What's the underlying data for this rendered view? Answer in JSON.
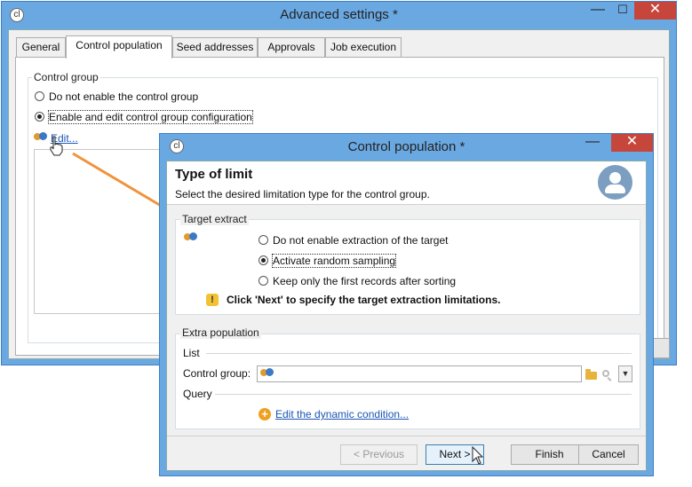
{
  "back_window": {
    "title": "Advanced settings *",
    "minimize": "—",
    "maximize": "☐",
    "close": "✕",
    "tabs": [
      "General",
      "Control population",
      "Seed addresses",
      "Approvals",
      "Job execution"
    ],
    "group_label": "Control group",
    "option_disable": "Do not enable the control group",
    "option_enable": "Enable and edit control group configuration",
    "edit_link": "Edit..."
  },
  "dialog": {
    "title": "Control population *",
    "minimize": "—",
    "close": "✕",
    "header_title": "Type of limit",
    "header_subtitle": "Select the desired limitation type for the control group.",
    "target_extract_label": "Target extract",
    "option_no_extraction": "Do not enable extraction of the target",
    "option_random_sampling": "Activate random sampling",
    "option_first_records": "Keep only the first records after sorting",
    "warning_text": "Click 'Next' to specify the target extraction limitations.",
    "extra_population_label": "Extra population",
    "list_label": "List",
    "control_group_label": "Control group:",
    "query_label": "Query",
    "condition_link": "Edit the dynamic condition...",
    "buttons": {
      "previous": "< Previous",
      "next": "Next >",
      "finish": "Finish",
      "cancel": "Cancel"
    }
  },
  "colors": {
    "title_bar": "#6aa8e2",
    "close_button": "#c7463c",
    "link": "#1a55b5",
    "arrow": "#f0943c",
    "warning": "#f1c232"
  },
  "selected_tab": "Control population",
  "selected_control_option": "Enable and edit control group configuration",
  "selected_extraction_option": "Activate random sampling"
}
